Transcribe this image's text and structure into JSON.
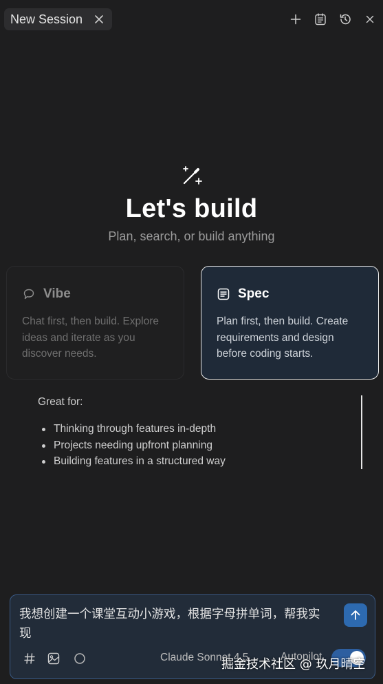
{
  "tab": {
    "title": "New Session"
  },
  "toolbar_icons": [
    "plus-icon",
    "task-list-icon",
    "history-icon",
    "close-icon"
  ],
  "hero": {
    "icon": "magic-wand-icon",
    "title": "Let's build",
    "subtitle": "Plan, search, or build anything"
  },
  "modes": [
    {
      "title": "Vibe",
      "icon": "chat-bubble-icon",
      "description": "Chat first, then build. Explore ideas and iterate as you discover needs.",
      "selected": false
    },
    {
      "title": "Spec",
      "icon": "document-icon",
      "description": "Plan first, then build. Create requirements and design before coding starts.",
      "selected": true
    }
  ],
  "great_for": {
    "title": "Great for:",
    "items": [
      "Thinking through features in-depth",
      "Projects needing upfront planning",
      "Building features in a structured way"
    ]
  },
  "composer": {
    "text": "我想创建一个课堂互动小游戏，根据字母拼单词，帮我实现",
    "model_label": "Claude Sonnet 4.5",
    "model_chevron": "⌄",
    "autopilot_label": "Autopilot",
    "autopilot_on": true
  },
  "colors": {
    "accent": "#2d6ab0",
    "background": "#1e1e1f",
    "spec_card": "#1f2a38"
  },
  "watermark": "掘金技术社区 @ 玖月晴空"
}
